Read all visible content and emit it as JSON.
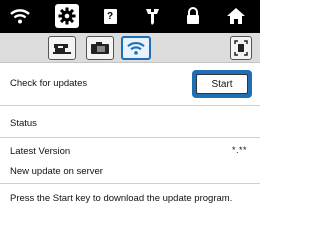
{
  "icons": {
    "wifi": "wifi-icon",
    "settings": "gear-icon",
    "help": "help-icon",
    "needle": "needle-icon",
    "lock": "lock-icon",
    "home": "home-icon",
    "machine": "sewing-machine-icon",
    "camera": "camera-icon",
    "wireless": "wifi-icon",
    "screen": "screen-capture-icon"
  },
  "colors": {
    "top_bar": "#000000",
    "accent": "#1e6fb5"
  },
  "help_glyph": "?",
  "check_updates": {
    "label": "Check for updates",
    "button_label": "Start"
  },
  "status": {
    "label": "Status"
  },
  "latest_version": {
    "label": "Latest Version",
    "value": "*.**"
  },
  "new_update": {
    "label": "New update on server"
  },
  "description": "Press the Start key to download the update program."
}
